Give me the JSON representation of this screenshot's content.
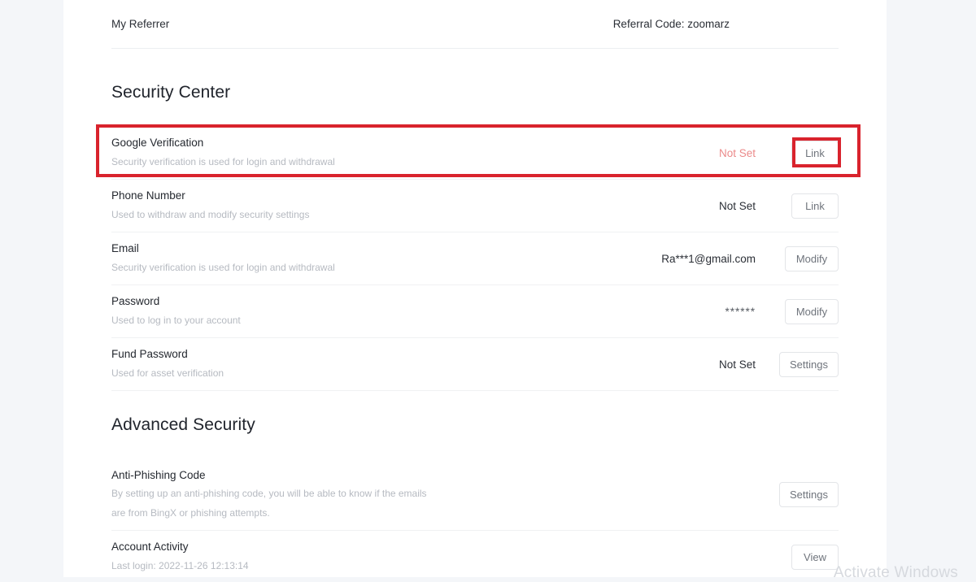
{
  "referrer": {
    "label": "My Referrer",
    "referral_code": "Referral Code: zoomarz"
  },
  "security_center": {
    "title": "Security Center",
    "rows": [
      {
        "title": "Google Verification",
        "desc": "Security verification is used for login and withdrawal",
        "value": "Not Set",
        "value_color": "#eb8a8a",
        "action": "Link"
      },
      {
        "title": "Phone Number",
        "desc": "Used to withdraw and modify security settings",
        "value": "Not Set",
        "value_color": "#2b2f36",
        "action": "Link"
      },
      {
        "title": "Email",
        "desc": "Security verification is used for login and withdrawal",
        "value": "Ra***1@gmail.com",
        "value_color": "#2b2f36",
        "action": "Modify"
      },
      {
        "title": "Password",
        "desc": "Used to log in to your account",
        "value": "******",
        "value_color": "#555a61",
        "action": "Modify"
      },
      {
        "title": "Fund Password",
        "desc": "Used for asset verification",
        "value": "Not Set",
        "value_color": "#2b2f36",
        "action": "Settings"
      }
    ]
  },
  "advanced_security": {
    "title": "Advanced Security",
    "rows": [
      {
        "title": "Anti-Phishing Code",
        "desc_line1": "By setting up an anti-phishing code, you will be able to know if the emails",
        "desc_line2": "are from BingX or phishing attempts.",
        "value": "",
        "action": "Settings"
      },
      {
        "title": "Account Activity",
        "desc": "Last login: 2022-11-26 12:13:14",
        "value": "",
        "action": "View"
      }
    ]
  },
  "annotations": {
    "highlight_color": "#d9232d",
    "highlighted_row": "Google Verification",
    "highlighted_button": "Link"
  },
  "watermark": {
    "text": "Activate Windows"
  }
}
